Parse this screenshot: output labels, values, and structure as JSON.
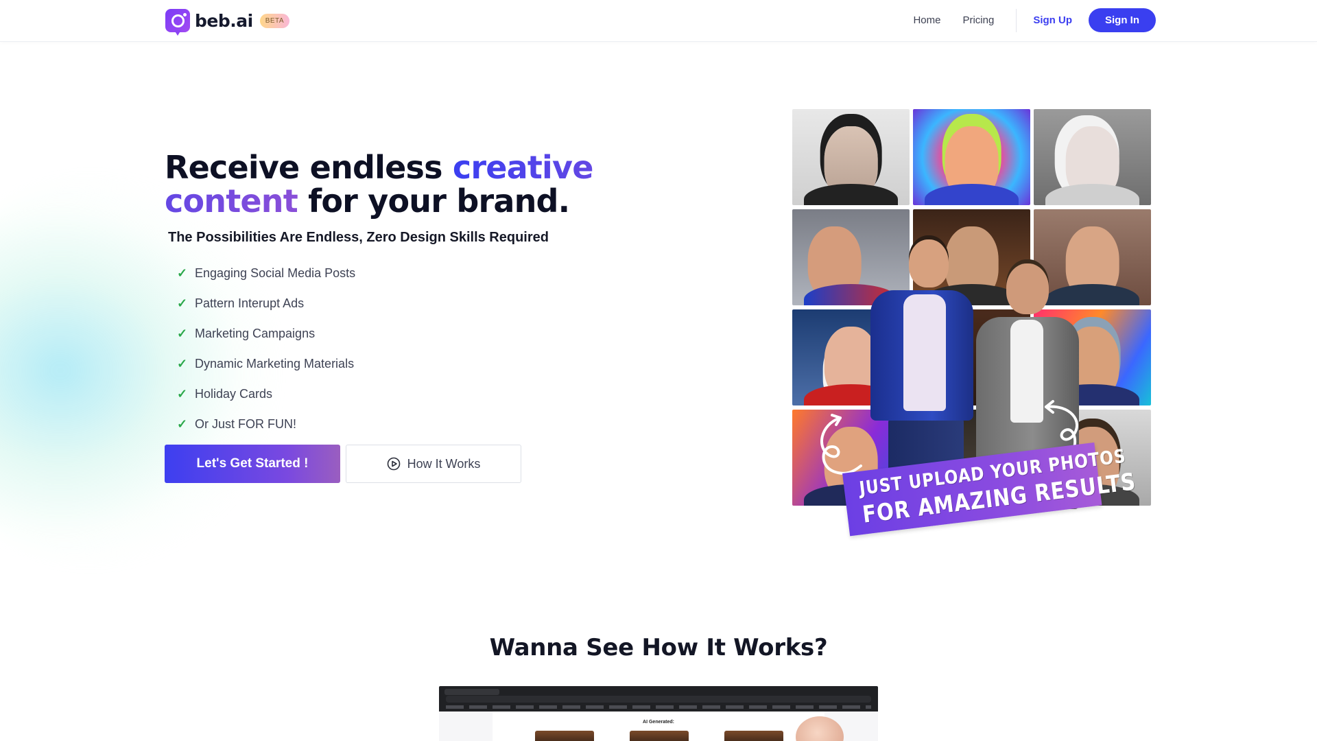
{
  "header": {
    "brand": "beb.ai",
    "beta_badge": "BETA",
    "nav": {
      "home": "Home",
      "pricing": "Pricing",
      "sign_up": "Sign Up",
      "sign_in": "Sign In"
    }
  },
  "hero": {
    "title_part1": "Receive endless ",
    "title_accent": "creative content",
    "title_part2": " for your brand.",
    "subtitle": "The Possibilities Are Endless, Zero Design Skills Required",
    "features": [
      "Engaging Social Media Posts",
      "Pattern Interupt Ads",
      "Marketing Campaigns",
      "Dynamic Marketing Materials",
      "Holiday Cards",
      "Or Just FOR FUN!"
    ],
    "primary_cta": "Let's Get Started !",
    "secondary_cta": "How It Works",
    "banner_line1": "JUST UPLOAD YOUR PHOTOS",
    "banner_line2": "FOR AMAZING RESULTS"
  },
  "how_it_works": {
    "title": "Wanna See How It Works?",
    "video_label": "AI Generated:"
  },
  "icons": {
    "check": "check-icon",
    "play": "play-circle-icon",
    "logo": "camera-pin-logo-icon"
  },
  "colors": {
    "primary": "#3a3ff0",
    "accent_purple": "#8a4fd8",
    "check_green": "#2aa84a"
  }
}
